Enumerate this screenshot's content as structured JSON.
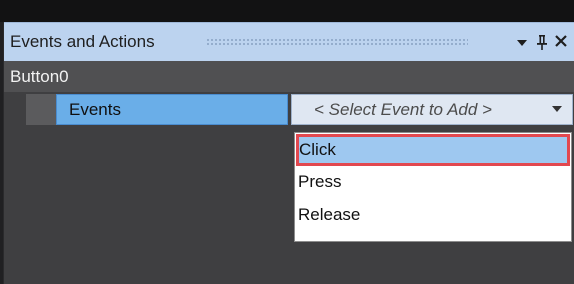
{
  "panel": {
    "title": "Events and Actions",
    "object_name": "Button0"
  },
  "titlebar_icons": [
    "chevron-down-icon",
    "pin-icon",
    "close-icon"
  ],
  "events_row": {
    "label": "Events",
    "select_placeholder": "< Select Event to Add >"
  },
  "dropdown": {
    "options": [
      "Click",
      "Press",
      "Release"
    ],
    "selected": "Click"
  },
  "colors": {
    "titlebar": "#bcd3ef",
    "events_cell": "#6aaee8",
    "highlight_border": "#e2484f",
    "selected_option": "#9ec8f0"
  }
}
